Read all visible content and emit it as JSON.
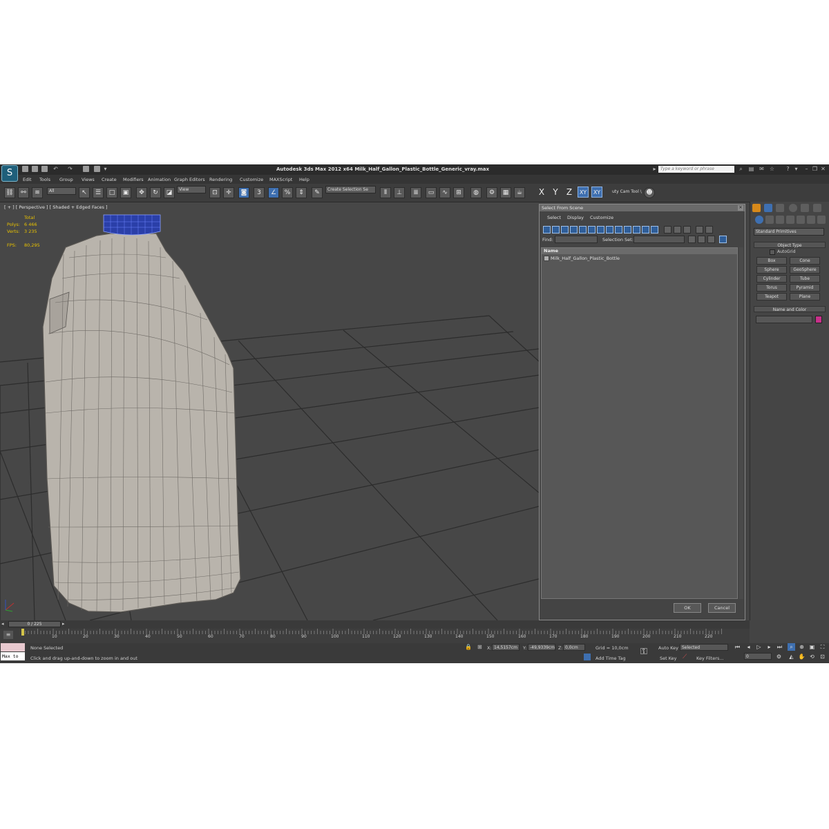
{
  "titlebar": {
    "title": "Autodesk 3ds Max  2012 x64     Milk_Half_Gallon_Plastic_Bottle_Generic_vray.max",
    "search_placeholder": "Type a keyword or phrase"
  },
  "menu": [
    "Edit",
    "Tools",
    "Group",
    "Views",
    "Create",
    "Modifiers",
    "Animation",
    "Graph Editors",
    "Rendering",
    "Customize",
    "MAXScript",
    "Help"
  ],
  "toolbar": {
    "selection_filter": "All",
    "reference_coord": "View",
    "named_selection": "Create Selection Se",
    "axis_x": "X",
    "axis_y": "Y",
    "axis_z": "Z",
    "axis_xy": "XY",
    "axis_xy2": "XY",
    "cam_tool": "uty Cam Tool \\"
  },
  "viewport": {
    "label": "[ + ] [ Perspective ] [ Shaded + Edged Faces ]",
    "stats_header": "Total",
    "polys_label": "Polys:",
    "polys_value": "6 466",
    "verts_label": "Verts:",
    "verts_value": "3 235",
    "fps_label": "FPS:",
    "fps_value": "80,295"
  },
  "dialog": {
    "title": "Select From Scene",
    "menu": [
      "Select",
      "Display",
      "Customize"
    ],
    "find_label": "Find:",
    "selection_set_label": "Selection Set:",
    "column_name": "Name",
    "items": [
      "Milk_Half_Gallon_Plastic_Bottle"
    ],
    "ok": "OK",
    "cancel": "Cancel"
  },
  "command_panel": {
    "category": "Standard Primitives",
    "object_type_header": "Object Type",
    "autogrid": "AutoGrid",
    "primitives": [
      "Box",
      "Cone",
      "Sphere",
      "GeoSphere",
      "Cylinder",
      "Tube",
      "Torus",
      "Pyramid",
      "Teapot",
      "Plane"
    ],
    "name_color_header": "Name and Color",
    "object_color": "#c8308a"
  },
  "timeline": {
    "frame_display": "0 / 225",
    "ticks": [
      "10",
      "20",
      "30",
      "40",
      "50",
      "60",
      "70",
      "80",
      "90",
      "100",
      "110",
      "120",
      "130",
      "140",
      "150",
      "160",
      "170",
      "180",
      "190",
      "200",
      "210",
      "220"
    ]
  },
  "status": {
    "maxscript_listener": "Max to",
    "selection": "None Selected",
    "prompt": "Click and drag up-and-down to zoom in and out",
    "x_label": "X:",
    "x_value": "14,5157cm",
    "y_label": "Y:",
    "y_value": "-49,9339cm",
    "z_label": "Z:",
    "z_value": "0,0cm",
    "grid": "Grid = 10,0cm",
    "add_time_tag": "Add Time Tag",
    "auto_key": "Auto Key",
    "key_mode": "Selected",
    "set_key": "Set Key",
    "key_filters": "Key Filters...",
    "current_frame": "0"
  },
  "colors": {
    "ui_bg": "#444444",
    "viewport_bg": "#474747",
    "active_blue": "#3e6fb0",
    "stats_yellow": "#e9c200",
    "bottle_cap": "#2a3fa8"
  }
}
